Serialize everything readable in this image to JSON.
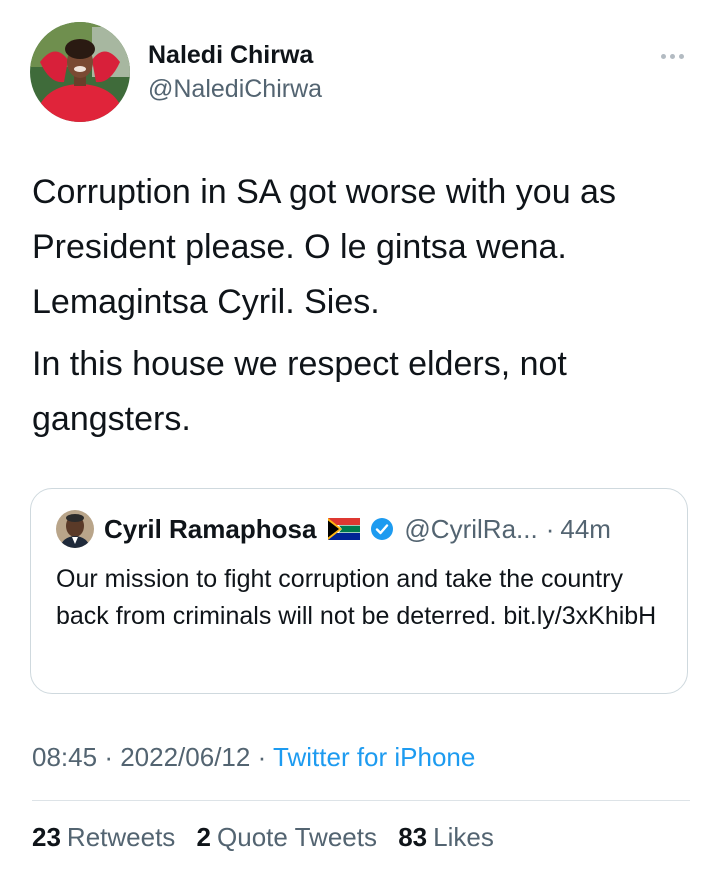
{
  "author": {
    "name": "Naledi Chirwa",
    "handle": "@NalediChirwa"
  },
  "tweet": {
    "paragraphs": [
      "Corruption in SA got worse with you as President please. O le gintsa wena. Lemagintsa Cyril. Sies.",
      "In this house we respect elders, not gangsters."
    ]
  },
  "quoted_tweet": {
    "name": "Cyril Ramaphosa",
    "handle": "@CyrilRa...",
    "separator": "·",
    "time": "44m",
    "text": "Our mission to fight corruption and take the country back from criminals will not be deterred. bit.ly/3xKhibH"
  },
  "meta": {
    "time": "08:45",
    "date": "2022/06/12",
    "separator": "·",
    "source": "Twitter for iPhone"
  },
  "stats": {
    "retweets": {
      "count": "23",
      "label": "Retweets"
    },
    "quotes": {
      "count": "2",
      "label": "Quote Tweets"
    },
    "likes": {
      "count": "83",
      "label": "Likes"
    }
  },
  "icons": {
    "more": "more-horizontal-icon",
    "verified": "verified-badge-icon",
    "flag": "south-africa-flag-icon"
  },
  "colors": {
    "text_primary": "#0f1419",
    "text_secondary": "#536471",
    "link": "#1d9bf0",
    "verified": "#1d9bf0",
    "border": "#cfd9de"
  }
}
